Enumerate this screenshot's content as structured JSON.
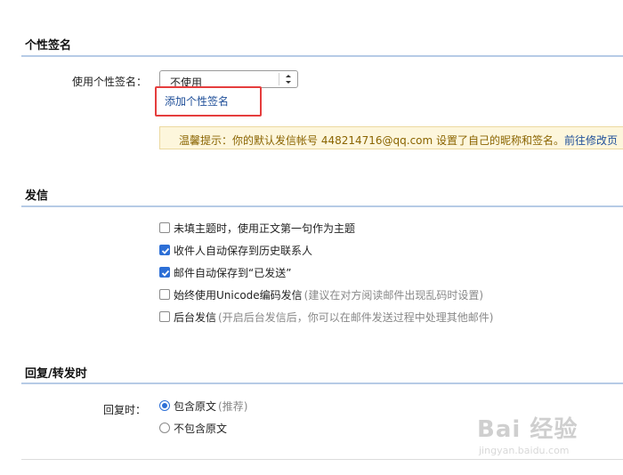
{
  "signature": {
    "section_title": "个性签名",
    "label": "使用个性签名：",
    "selected_value": "不使用",
    "add_link": "添加个性签名",
    "tip_text": "温馨提示：你的默认发信帐号 448214716@qq.com 设置了自己的昵称和签名。",
    "tip_link": "前往修改页"
  },
  "send": {
    "section_title": "发信",
    "options": [
      {
        "label": "未填主题时，使用正文第一句作为主题",
        "hint": "",
        "checked": false
      },
      {
        "label": "收件人自动保存到历史联系人",
        "hint": "",
        "checked": true
      },
      {
        "label": "邮件自动保存到“已发送”",
        "hint": "",
        "checked": true
      },
      {
        "label": "始终使用Unicode编码发信",
        "hint": "(建议在对方阅读邮件出现乱码时设置)",
        "checked": false
      },
      {
        "label": "后台发信",
        "hint": "(开启后台发信后，你可以在邮件发送过程中处理其他邮件)",
        "checked": false
      }
    ]
  },
  "reply": {
    "section_title": "回复/转发时",
    "label": "回复时：",
    "options": [
      {
        "label": "包含原文",
        "hint": "(推荐)",
        "selected": true
      },
      {
        "label": "不包含原文",
        "hint": "",
        "selected": false
      }
    ]
  },
  "watermark": {
    "text": "Bai 经验",
    "sub": "jingyan.baidu.com"
  },
  "colors": {
    "accent": "#2d6fd6",
    "link": "#1f4f99",
    "highlight": "#e53d3d",
    "tip_bg": "#fdf6dc",
    "tip_text": "#8a6400"
  }
}
